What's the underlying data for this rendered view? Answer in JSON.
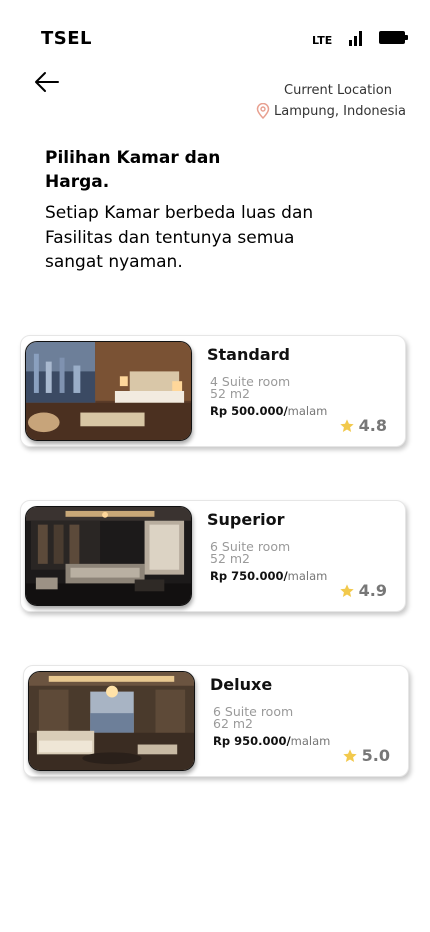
{
  "status_bar": {
    "carrier": "TSEL",
    "network": "LTE"
  },
  "header": {
    "location_label": "Current Location",
    "location_value": "Lampung, Indonesia"
  },
  "intro": {
    "title": "Pilihan Kamar dan Harga.",
    "description": "Setiap Kamar berbeda luas dan Fasilitas dan tentunya semua sangat nyaman."
  },
  "rooms": [
    {
      "name": "Standard",
      "rooms": "4 Suite room",
      "size": "52 m2",
      "price": "Rp 500.000/",
      "unit": "malam",
      "rating": "4.8"
    },
    {
      "name": "Superior",
      "rooms": "6 Suite room",
      "size": "52 m2",
      "price": "Rp 750.000/",
      "unit": "malam",
      "rating": "4.9"
    },
    {
      "name": "Deluxe",
      "rooms": "6 Suite room",
      "size": "62 m2",
      "price": "Rp 950.000/",
      "unit": "malam",
      "rating": "5.0"
    }
  ],
  "colors": {
    "star": "#f2c94c",
    "location_pin": "#e8a090",
    "muted_text": "#9a9a9a"
  }
}
